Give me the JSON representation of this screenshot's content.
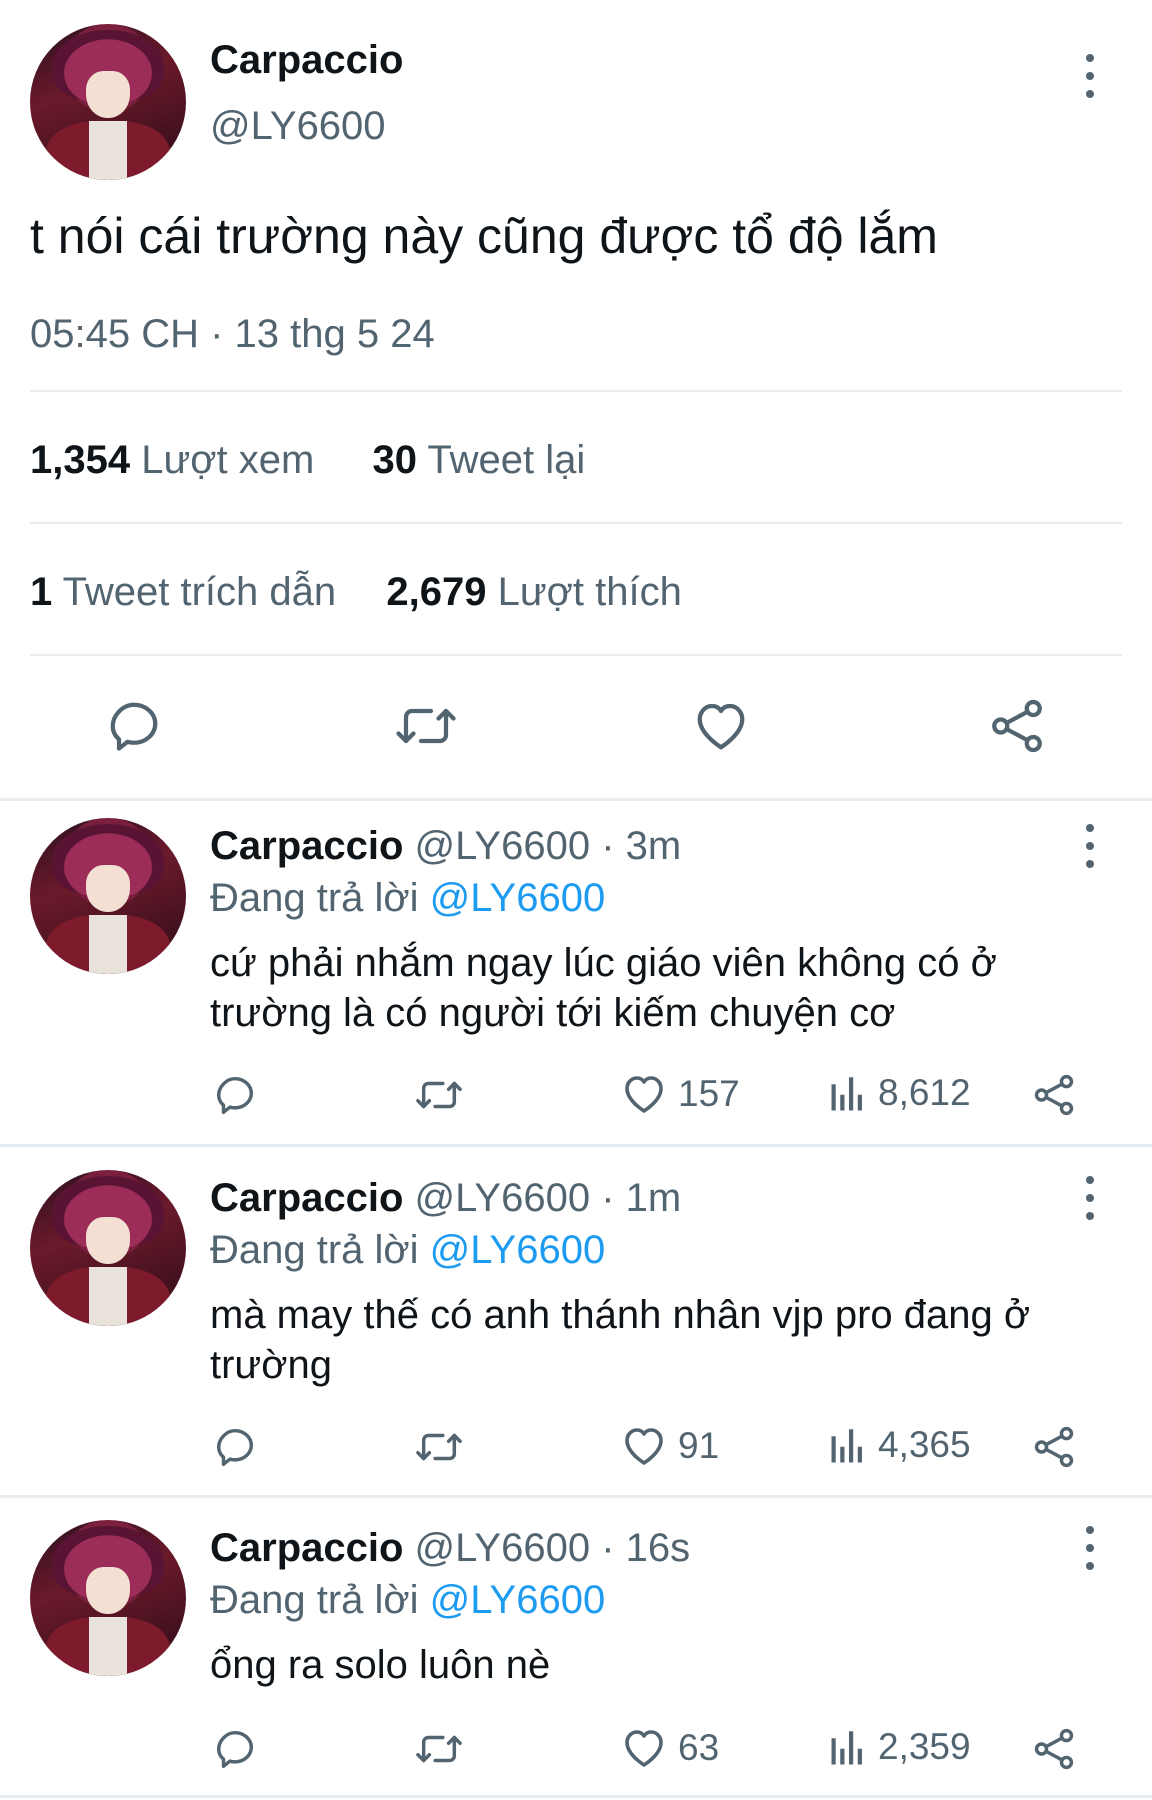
{
  "tweet": {
    "display_name": "Carpaccio",
    "handle": "@LY6600",
    "text": "t nói cái trường này cũng được tổ độ lắm",
    "timestamp": "05:45 CH · 13 thg 5 24",
    "stats": {
      "views_count": "1,354",
      "views_label": "Lượt xem",
      "retweets_count": "30",
      "retweets_label": "Tweet lại",
      "quotes_count": "1",
      "quotes_label": "Tweet trích dẫn",
      "likes_count": "2,679",
      "likes_label": "Lượt thích"
    },
    "actions": [
      "reply-icon",
      "retweet-icon",
      "like-icon",
      "share-icon"
    ]
  },
  "replies": [
    {
      "display_name": "Carpaccio",
      "handle_time": "@LY6600 · 3m",
      "replying_prefix": "Đang trả lời",
      "replying_to": "@LY6600",
      "text": "cứ phải nhắm ngay lúc giáo viên không có ở trường là có người tới kiếm chuyện cơ",
      "likes": "157",
      "views": "8,612"
    },
    {
      "display_name": "Carpaccio",
      "handle_time": "@LY6600 · 1m",
      "replying_prefix": "Đang trả lời",
      "replying_to": "@LY6600",
      "text": "mà may thế có anh thánh nhân vjp pro đang ở trường",
      "likes": "91",
      "views": "4,365"
    },
    {
      "display_name": "Carpaccio",
      "handle_time": "@LY6600 · 16s",
      "replying_prefix": "Đang trả lời",
      "replying_to": "@LY6600",
      "text": "ổng ra solo luôn nè",
      "likes": "63",
      "views": "2,359"
    }
  ],
  "colors": {
    "text": "#0f1419",
    "secondary": "#536471",
    "link": "#1d9bf0",
    "divider": "#e6ecf0"
  }
}
